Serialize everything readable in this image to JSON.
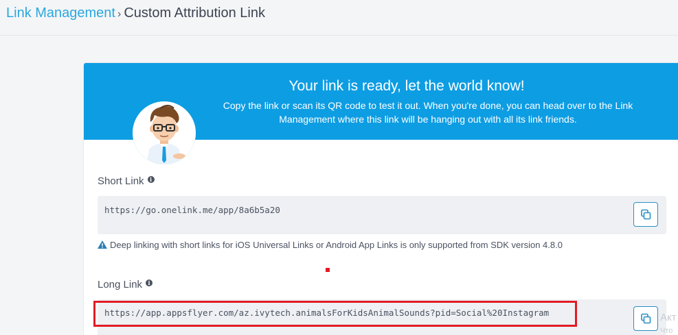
{
  "breadcrumb": {
    "parent": "Link Management",
    "separator": "›",
    "current": "Custom Attribution Link"
  },
  "banner": {
    "title": "Your link is ready, let the world know!",
    "text": "Copy the link or scan its QR code to test it out. When you're done, you can head over to the Link Management where this link will be hanging out with all its link friends.",
    "color": "#0d9de3"
  },
  "short_link": {
    "label": "Short Link",
    "value": "https://go.onelink.me/app/8a6b5a20",
    "copy_icon": "copy-icon"
  },
  "warning": {
    "text": "Deep linking with short links for iOS Universal Links or Android App Links is only supported from SDK version 4.8.0",
    "icon": "warning-icon"
  },
  "long_link": {
    "label": "Long Link",
    "value": "https://app.appsflyer.com/az.ivytech.animalsForKidsAnimalSounds?pid=Social%20Instagram",
    "copy_icon": "copy-icon"
  },
  "watermark": {
    "line1": "Акт",
    "line2": "Что"
  },
  "colors": {
    "accent": "#2aa7df",
    "highlight": "#e31b23"
  }
}
